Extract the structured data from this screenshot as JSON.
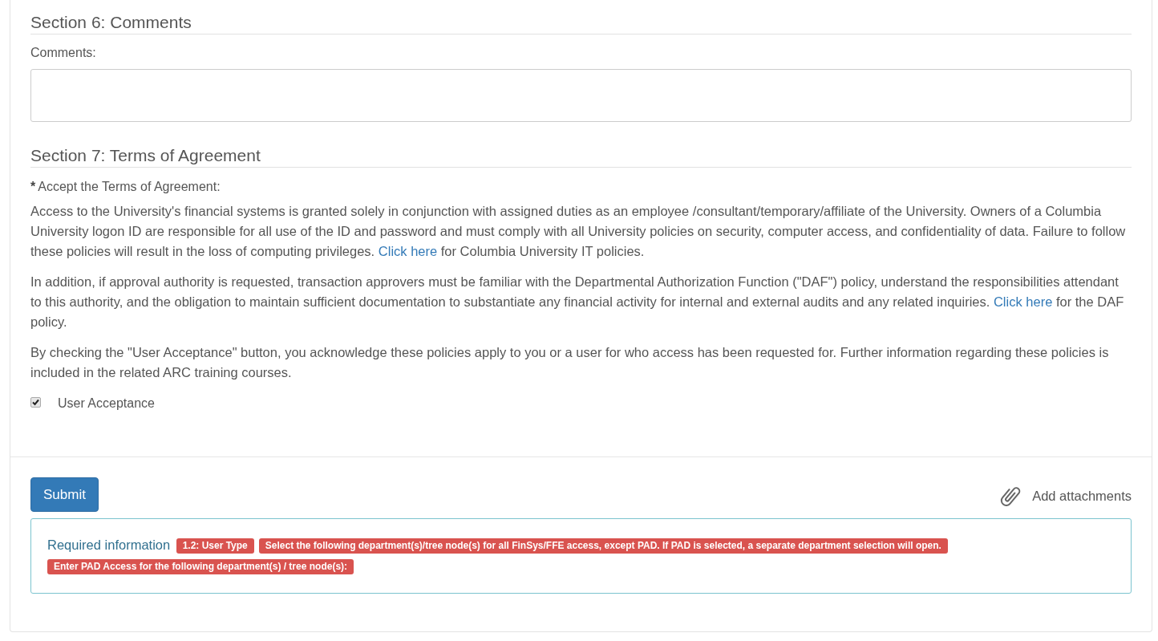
{
  "comments_section": {
    "title": "Section 6: Comments",
    "label": "Comments:"
  },
  "terms_section": {
    "title": "Section 7: Terms of Agreement",
    "required_mark": "*",
    "label": "Accept the Terms of Agreement:",
    "paragraphs": [
      [
        {
          "kind": "text",
          "text": "Access to the University's financial systems is granted solely in conjunction with assigned duties as an employee /consultant/temporary/affiliate of the University. Owners of a Columbia University logon ID are responsible for all use of the ID and password and must comply with all University policies on security, computer access, and confidentiality of data. Failure to follow these policies will result in the loss of computing privileges. "
        },
        {
          "kind": "link",
          "text": "Click here"
        },
        {
          "kind": "text",
          "text": " for Columbia University IT policies."
        }
      ],
      [
        {
          "kind": "text",
          "text": "In addition, if approval authority is requested, transaction approvers must be familiar with the Departmental Authorization Function (\"DAF\") policy, understand the responsibilities attendant to this authority, and the obligation to maintain sufficient documentation to substantiate any financial activity for internal and external audits and any related inquiries. "
        },
        {
          "kind": "link",
          "text": "Click here"
        },
        {
          "kind": "text",
          "text": " for the DAF policy."
        }
      ],
      [
        {
          "kind": "text",
          "text": "By checking the \"User Acceptance\" button, you acknowledge these policies apply to you or a user for who access has been requested for. Further information regarding these policies is included in the related ARC training courses."
        }
      ]
    ],
    "checkbox": {
      "label": "User Acceptance",
      "checked": true
    }
  },
  "footer": {
    "submit": "Submit",
    "attachments": "Add attachments",
    "required_info": {
      "title": "Required information",
      "badges": [
        "1.2: User Type",
        "Select the following department(s)/tree node(s) for all FinSys/FFE access, except PAD. If PAD is selected, a separate department selection will open.",
        "Enter PAD Access for the following department(s) / tree node(s):"
      ]
    }
  }
}
